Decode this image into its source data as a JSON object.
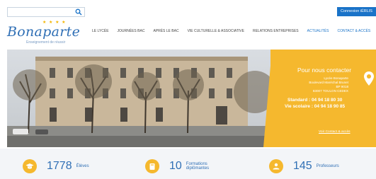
{
  "topbar": {
    "search_placeholder": "",
    "connect_label": "Connexion iÉRLIS"
  },
  "logo": {
    "name": "Bonaparte",
    "tagline": "Enseignement de réussir",
    "stars": "★ ★ ★ ★"
  },
  "nav": {
    "items": [
      {
        "label": "LE LYCÉE",
        "active": false
      },
      {
        "label": "JOURNÉES BAC",
        "active": false
      },
      {
        "label": "APRÈS LE BAC",
        "active": false
      },
      {
        "label": "VIE CULTURELLE & ASSOCIATIVE",
        "active": false
      },
      {
        "label": "RELATIONS ENTREPRISES",
        "active": false
      },
      {
        "label": "ACTUALITÉS",
        "active": true
      },
      {
        "label": "CONTACT & ACCÈS",
        "active": true
      }
    ]
  },
  "contact": {
    "title": "Pour nous contacter",
    "line1": "Lycée Bonaparte",
    "line2": "Boulevard Maréchal Brunet",
    "line3": "BP 9018",
    "line4": "83007 TOULON CEDEX",
    "standard": "Standard : 04 94 18 80 30",
    "vie_scolaire": "Vie scolaire : 04 94 18 90 85",
    "link": "Voir Contact & accès"
  },
  "stats": [
    {
      "number": "1778",
      "label": "Élèves",
      "icon": "graduation-cap-icon"
    },
    {
      "number": "10",
      "label": "Formations diplômantes",
      "icon": "book-icon"
    },
    {
      "number": "145",
      "label": "Professeurs",
      "icon": "teacher-icon"
    }
  ],
  "colors": {
    "brand_blue": "#2f6fb5",
    "accent_yellow": "#f5b82e",
    "button_blue": "#1a73c8"
  }
}
